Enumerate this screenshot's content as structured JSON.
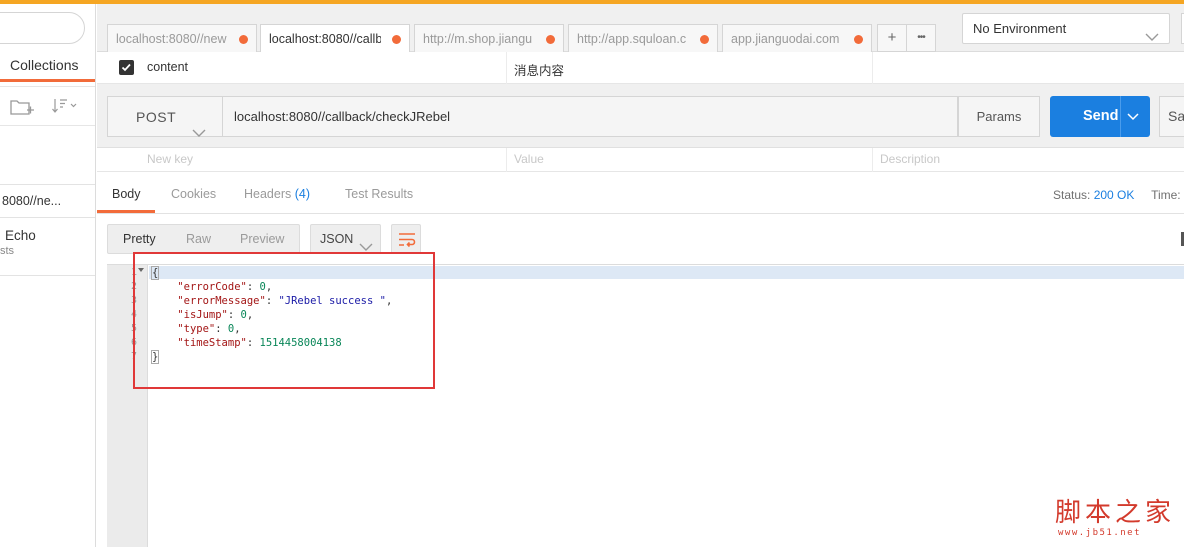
{
  "sidebar": {
    "tab_collections": "Collections",
    "history_item": "8080//ne...",
    "echo_title": "Echo",
    "echo_sub": "sts"
  },
  "tabs": [
    {
      "label": "localhost:8080//new",
      "modified": true
    },
    {
      "label": "localhost:8080//callb",
      "modified": true,
      "active": true
    },
    {
      "label": "http://m.shop.jiangu",
      "modified": true
    },
    {
      "label": "http://app.squloan.c",
      "modified": true
    },
    {
      "label": "app.jianguodai.com",
      "modified": true
    }
  ],
  "tab_actions": {
    "add": "+",
    "more": "•••"
  },
  "environment": {
    "selected": "No Environment"
  },
  "param_row": {
    "checked": true,
    "key": "content",
    "value": "消息内容"
  },
  "request": {
    "method": "POST",
    "url": "localhost:8080//callback/checkJRebel",
    "params_label": "Params",
    "send_label": "Send",
    "save_label": "Sa"
  },
  "placeholders": {
    "key": "New key",
    "value": "Value",
    "description": "Description"
  },
  "response_tabs": {
    "body": "Body",
    "cookies": "Cookies",
    "headers": "Headers",
    "headers_count": "(4)",
    "test_results": "Test Results"
  },
  "status": {
    "label": "Status:",
    "value": "200 OK",
    "time_label": "Time:"
  },
  "format": {
    "pretty": "Pretty",
    "raw": "Raw",
    "preview": "Preview",
    "type": "JSON"
  },
  "response_body": {
    "line_numbers": [
      "1",
      "2",
      "3",
      "4",
      "5",
      "6",
      "7"
    ],
    "open_brace": "{",
    "close_brace": "}",
    "fields": [
      {
        "key": "\"errorCode\"",
        "value": "0",
        "kind": "number",
        "comma": ","
      },
      {
        "key": "\"errorMessage\"",
        "value": "\"JRebel success \"",
        "kind": "string",
        "comma": ","
      },
      {
        "key": "\"isJump\"",
        "value": "0",
        "kind": "number",
        "comma": ","
      },
      {
        "key": "\"type\"",
        "value": "0",
        "kind": "number",
        "comma": ","
      },
      {
        "key": "\"timeStamp\"",
        "value": "1514458004138",
        "kind": "number",
        "comma": ""
      }
    ]
  },
  "watermark": {
    "main": "脚本之家",
    "url": "www.jb51.net"
  },
  "colors": {
    "accent": "#f26b3a",
    "send": "#1b7fe0",
    "highlight": "#e03838",
    "top_stripe": "#f5a623"
  }
}
